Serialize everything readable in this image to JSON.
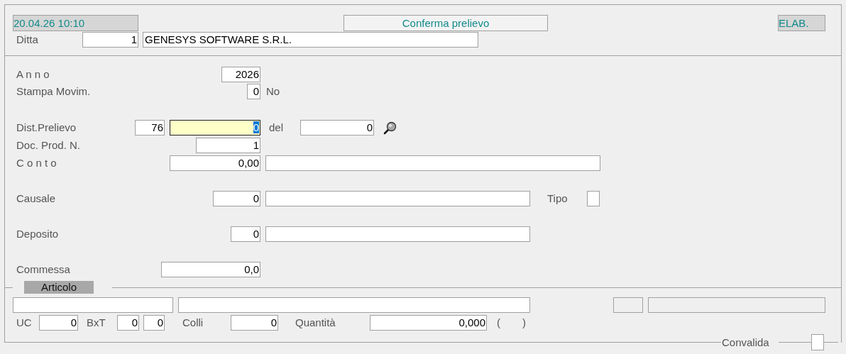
{
  "header": {
    "datetime": "20.04.26 10:10",
    "title": "Conferma prelievo",
    "status": "ELAB."
  },
  "ditta": {
    "label": "Ditta",
    "code": "1",
    "name": "GENESYS SOFTWARE S.R.L."
  },
  "anno": {
    "label": "A n n o",
    "value": "2026"
  },
  "stampa": {
    "label": "Stampa Movim.",
    "value": "0",
    "text": "No"
  },
  "dist": {
    "label": "Dist.Prelievo",
    "number": "76",
    "value": "0",
    "focused": true,
    "del_label": "del",
    "date": "0"
  },
  "doc": {
    "label": "Doc. Prod. N.",
    "value": "1"
  },
  "conto": {
    "label": "C o n t o",
    "value": "0,00"
  },
  "causale": {
    "label": "Causale",
    "value": "0",
    "tipo_label": "Tipo"
  },
  "deposito": {
    "label": "Deposito",
    "value": "0"
  },
  "commessa": {
    "label": "Commessa",
    "value": "0,0"
  },
  "articolo": {
    "tab": "Articolo",
    "uc_label": "UC",
    "uc": "0",
    "bxt_label": "BxT",
    "bxt_1": "0",
    "bxt_2": "0",
    "colli_label": "Colli",
    "colli": "0",
    "quantita_label": "Quantità",
    "quantita": "0,000",
    "open_paren": "(",
    "close_paren": ")"
  },
  "convalida": {
    "label": "Convalida",
    "checked": false
  }
}
